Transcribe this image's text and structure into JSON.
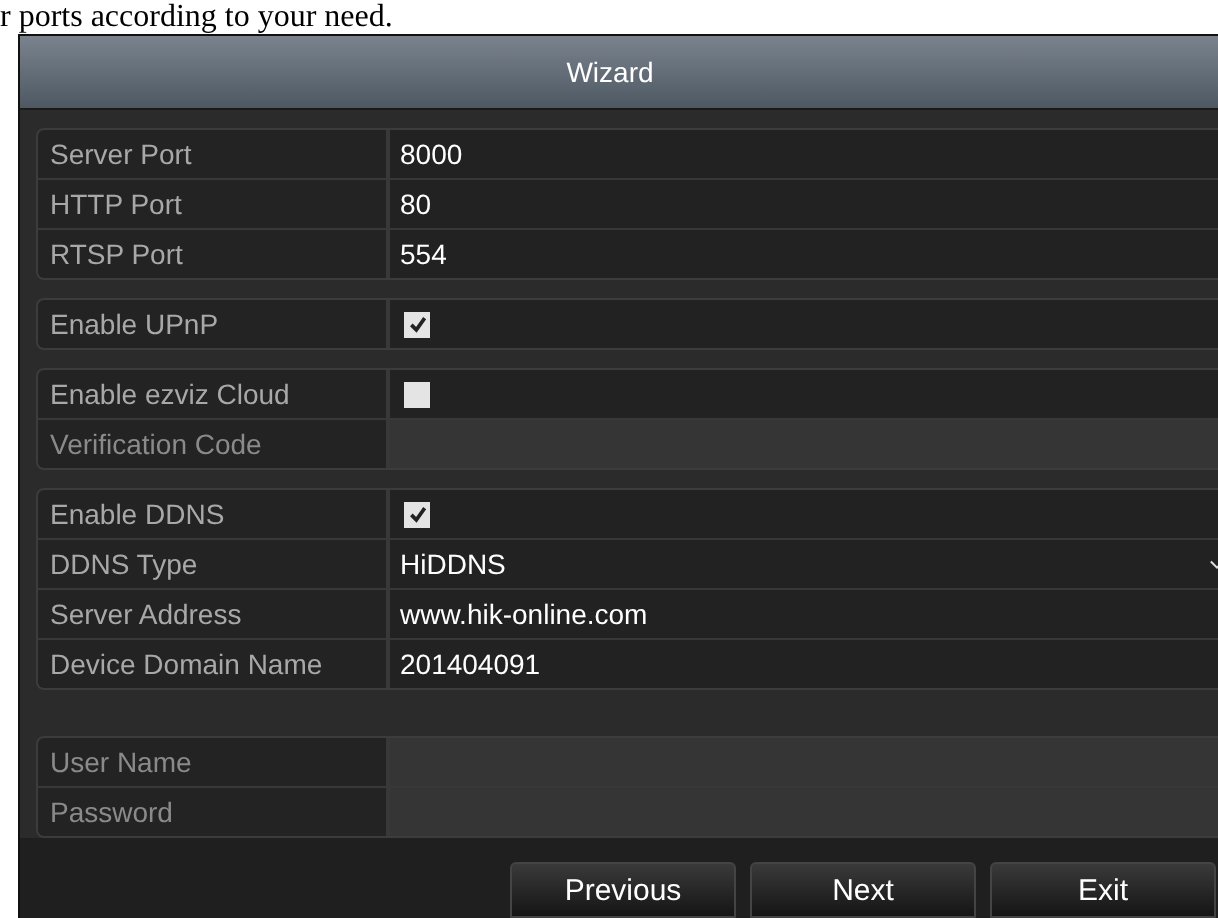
{
  "intro_text": "r ports according to your need.",
  "window": {
    "title": "Wizard"
  },
  "groups": [
    {
      "fields": [
        {
          "kind": "text",
          "label": "Server Port",
          "value": "8000",
          "disabled": false
        },
        {
          "kind": "text",
          "label": "HTTP Port",
          "value": "80",
          "disabled": false
        },
        {
          "kind": "text",
          "label": "RTSP Port",
          "value": "554",
          "disabled": false
        }
      ]
    },
    {
      "fields": [
        {
          "kind": "checkbox",
          "label": "Enable UPnP",
          "checked": true,
          "disabled": false
        }
      ]
    },
    {
      "fields": [
        {
          "kind": "checkbox",
          "label": "Enable ezviz Cloud",
          "checked": false,
          "disabled": false
        },
        {
          "kind": "text",
          "label": "Verification Code",
          "disabled": true
        }
      ]
    },
    {
      "fields": [
        {
          "kind": "checkbox",
          "label": "Enable DDNS",
          "checked": true,
          "disabled": false
        },
        {
          "kind": "select",
          "label": "DDNS Type",
          "value": "HiDDNS",
          "disabled": false
        },
        {
          "kind": "text",
          "label": "Server Address",
          "value": "www.hik-online.com",
          "disabled": false
        },
        {
          "kind": "text",
          "label": "Device Domain Name",
          "value": "201404091",
          "disabled": false
        }
      ]
    },
    {
      "fields": [
        {
          "kind": "text",
          "label": "User Name",
          "disabled": true
        },
        {
          "kind": "text",
          "label": "Password",
          "disabled": true
        }
      ]
    }
  ],
  "buttons": [
    "Previous",
    "Next",
    "Exit"
  ]
}
